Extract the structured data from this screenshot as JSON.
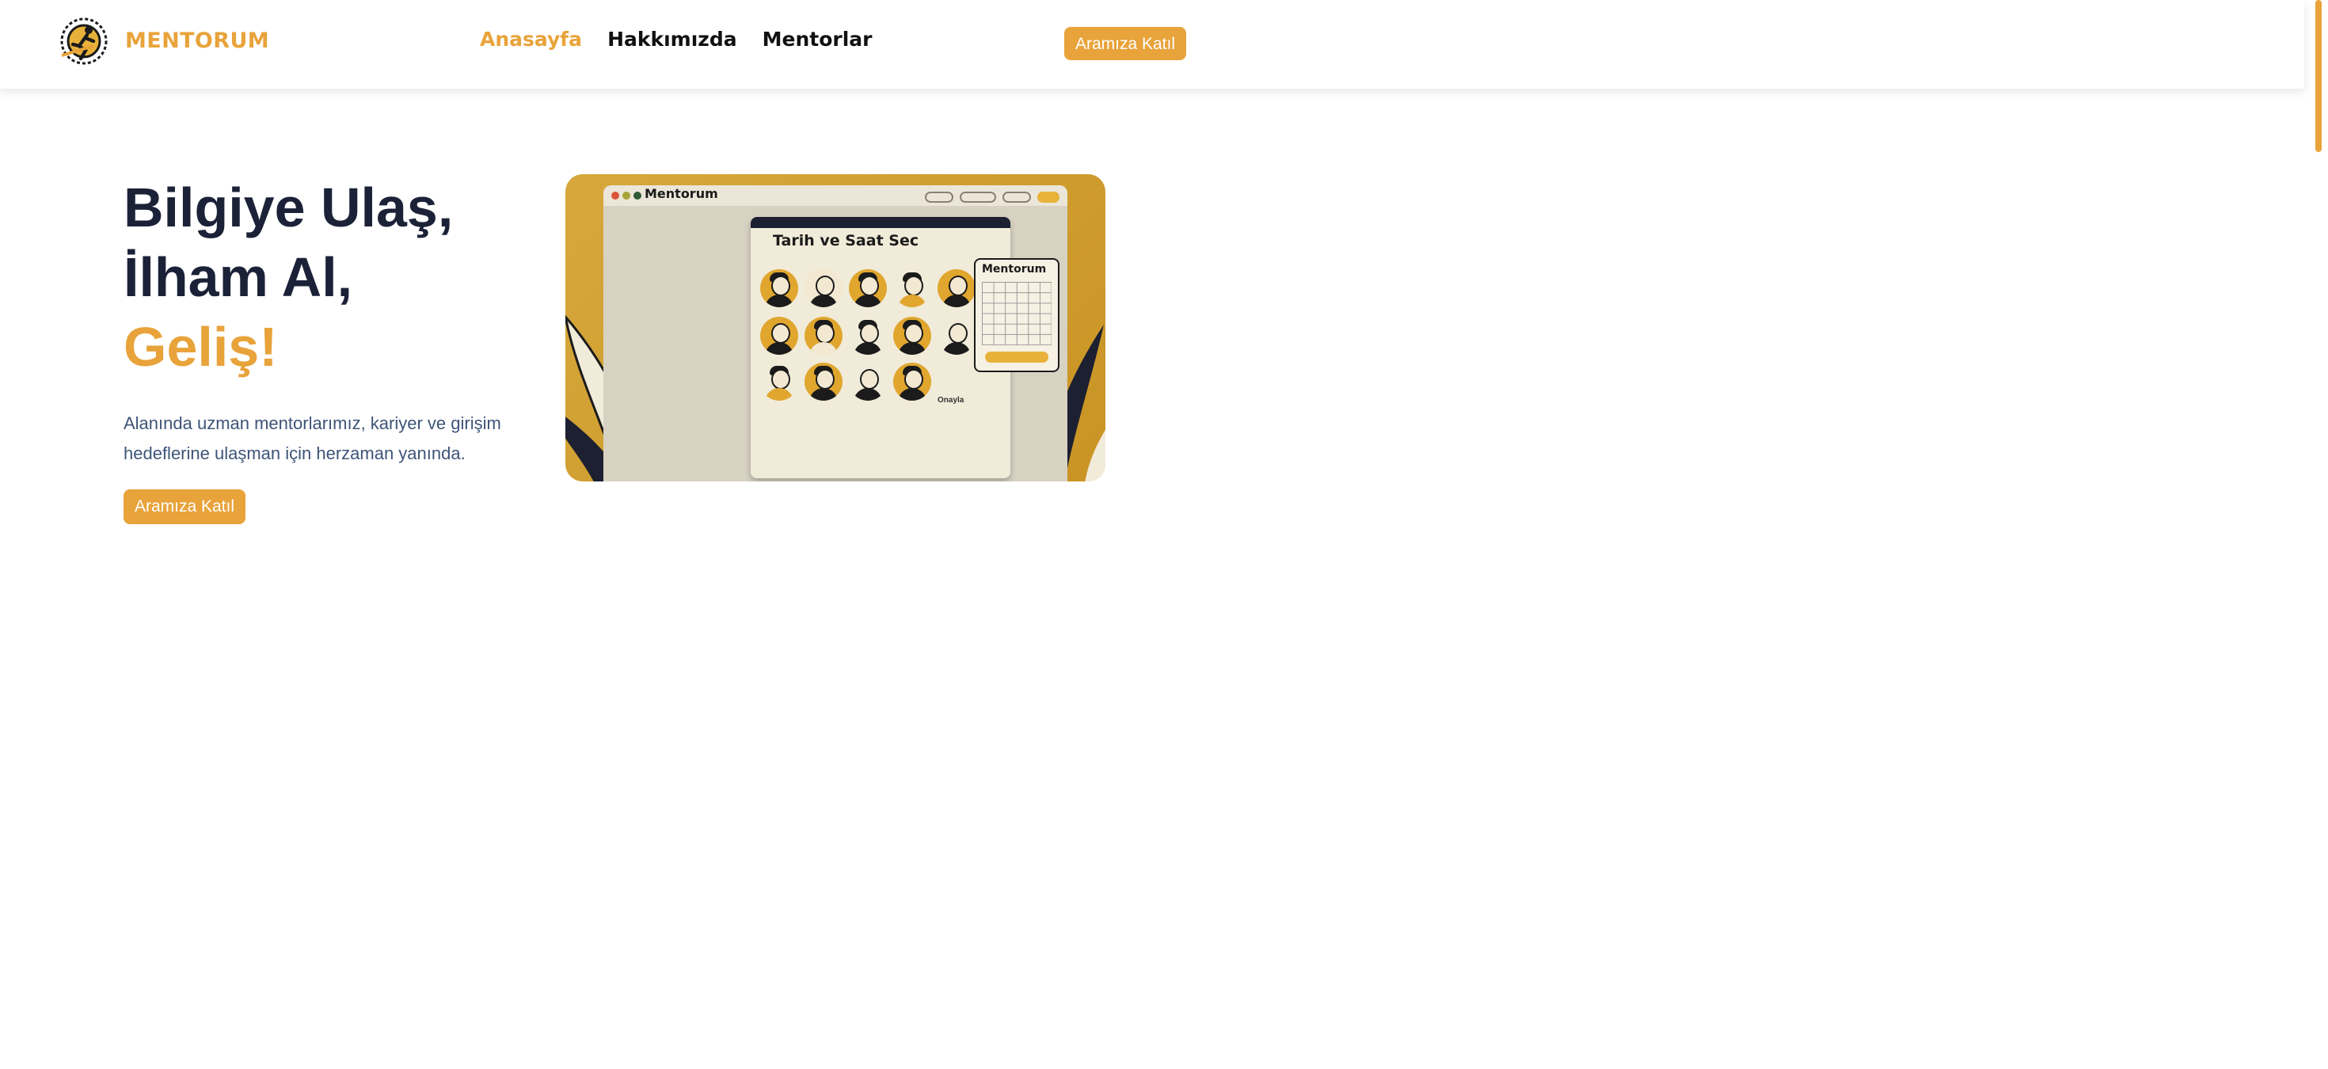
{
  "header": {
    "brand": "MENTORUM",
    "nav": [
      {
        "label": "Anasayfa",
        "active": true
      },
      {
        "label": "Hakkımızda",
        "active": false
      },
      {
        "label": "Mentorlar",
        "active": false
      }
    ],
    "cta_label": "Aramıza Katıl"
  },
  "hero": {
    "title_line1": "Bilgiye Ulaş,",
    "title_line2": "İlham Al,",
    "title_line3": "Geliş!",
    "description": "Alanında uzman mentorlarımız, kariyer ve girişim hedeflerine ulaşman için herzaman yanında.",
    "cta_label": "Aramıza Katıl"
  },
  "illustration": {
    "window_title": "Mentorum",
    "panel_title": "Tarih ve   Saat Sec",
    "calendar_title": "Mentorum",
    "confirm_label": "Onayla"
  },
  "colors": {
    "accent": "#e8a33a",
    "heading": "#1b2238",
    "body_text": "#3e5478"
  }
}
